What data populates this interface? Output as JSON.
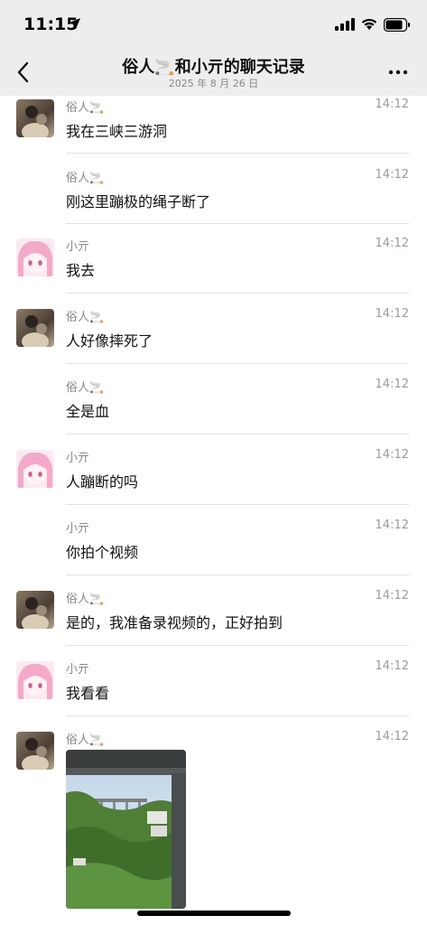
{
  "status": {
    "time": "11:15"
  },
  "nav": {
    "title": "俗人🚬和小亓的聊天记录",
    "subtitle": "2025 年 8 月 26 日"
  },
  "messages": [
    {
      "sender": "俗人🚬",
      "time": "14:12",
      "text": "我在三峡三游洞",
      "avatar": "male"
    },
    {
      "sender": "俗人🚬",
      "time": "14:12",
      "text": "刚这里蹦极的绳子断了",
      "avatar": ""
    },
    {
      "sender": "小亓",
      "time": "14:12",
      "text": "我去",
      "avatar": "anime"
    },
    {
      "sender": "俗人🚬",
      "time": "14:12",
      "text": "人好像摔死了",
      "avatar": "male"
    },
    {
      "sender": "俗人🚬",
      "time": "14:12",
      "text": "全是血",
      "avatar": ""
    },
    {
      "sender": "小亓",
      "time": "14:12",
      "text": "人蹦断的吗",
      "avatar": "anime"
    },
    {
      "sender": "小亓",
      "time": "14:12",
      "text": "你拍个视频",
      "avatar": ""
    },
    {
      "sender": "俗人🚬",
      "time": "14:12",
      "text": "是的，我准备录视频的，正好拍到",
      "avatar": "male"
    },
    {
      "sender": "小亓",
      "time": "14:12",
      "text": "我看看",
      "avatar": "anime"
    },
    {
      "sender": "俗人🚬",
      "time": "14:12",
      "text": "",
      "avatar": "male"
    }
  ],
  "icons": {
    "back": "chevron-left-icon",
    "more": "more-icon",
    "location": "location-arrow-icon",
    "signal": "signal-icon",
    "wifi": "wifi-icon",
    "battery": "battery-icon"
  }
}
